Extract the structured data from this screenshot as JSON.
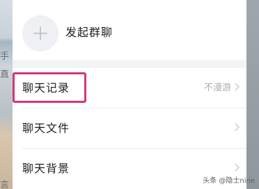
{
  "background": {
    "left_fragments": [
      "手",
      "直",
      "言"
    ]
  },
  "group_actions": {
    "start_group_label": "发起群聊"
  },
  "settings_list": [
    {
      "label": "聊天记录",
      "value": "不漫游"
    },
    {
      "label": "聊天文件",
      "value": ""
    },
    {
      "label": "聊天背景",
      "value": ""
    }
  ],
  "watermark": {
    "text": "头条 @隐士nine"
  },
  "colors": {
    "highlight": "#d5347a",
    "panel_bg": "#f2f3f5"
  },
  "icons": {
    "add": "plus-icon",
    "row_arrow": "chevron-right-icon"
  }
}
